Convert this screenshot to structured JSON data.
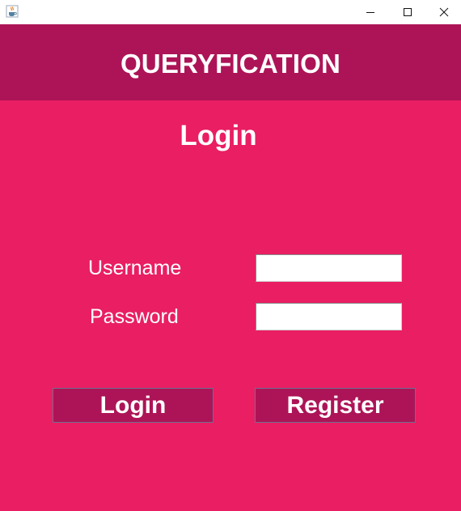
{
  "window": {
    "app_icon": "java-coffee-cup-icon",
    "controls": {
      "minimize_icon": "minimize-icon",
      "maximize_icon": "maximize-icon",
      "close_icon": "close-icon"
    }
  },
  "header": {
    "title": "QUERYFICATION"
  },
  "form": {
    "heading": "Login",
    "username_label": "Username",
    "username_value": "",
    "password_label": "Password",
    "password_value": "",
    "login_button": "Login",
    "register_button": "Register"
  },
  "colors": {
    "header_background": "#ad1457",
    "body_background": "#e91e63",
    "button_background": "#ad1457",
    "text": "#ffffff"
  }
}
